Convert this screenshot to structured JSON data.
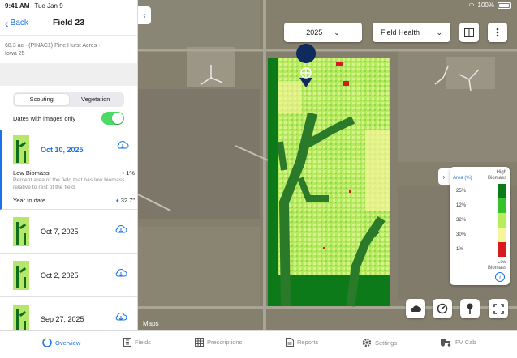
{
  "status_bar": {
    "time": "9:41 AM",
    "date": "Tue Jan 9",
    "battery": "100%"
  },
  "nav": {
    "back_label": "Back",
    "title": "Field 23"
  },
  "field_info": {
    "line1": "68.3 ac · (PINAC1) Pine Hurst Acres ·",
    "line2": "Iowa 25"
  },
  "segments": [
    {
      "label": "Scouting",
      "active": true
    },
    {
      "label": "Vegetation",
      "active": false
    }
  ],
  "toggle": {
    "label": "Dates with images only",
    "on": true
  },
  "dates": {
    "selected": {
      "label": "Oct 10, 2025",
      "metric_title": "Low Biomass",
      "metric_value": "1%",
      "metric_desc": "Percent area of the field that has low biomass relative to rest of the field.",
      "ytd_label": "Year to date",
      "ytd_value": "32.7\""
    },
    "others": [
      "Oct 7, 2025",
      "Oct 2, 2025",
      "Sep 27, 2025"
    ]
  },
  "map": {
    "year": "2025",
    "view": "Field Health",
    "maps_logo": "Maps",
    "legend": {
      "area_label": "Area (%)",
      "high_label": "High Biomass",
      "low_label": "Low Biomass",
      "rows": [
        {
          "pct": "25%",
          "color": "#0d7a19"
        },
        {
          "pct": "12%",
          "color": "#35c22a"
        },
        {
          "pct": "32%",
          "color": "#b8ec5a"
        },
        {
          "pct": "30%",
          "color": "#f6f59a"
        },
        {
          "pct": "1%",
          "color": "#d71920"
        }
      ]
    }
  },
  "tabbar": [
    {
      "label": "Overview",
      "icon": "overview-icon",
      "active": true
    },
    {
      "label": "Fields",
      "icon": "fields-icon",
      "active": false
    },
    {
      "label": "Prescriptions",
      "icon": "prescriptions-icon",
      "active": false
    },
    {
      "label": "Reports",
      "icon": "reports-icon",
      "active": false
    },
    {
      "label": "Settings",
      "icon": "gear-icon",
      "active": false
    },
    {
      "label": "FV Cab",
      "icon": "tractor-icon",
      "active": false
    }
  ],
  "colors": {
    "accent": "#1a73e8",
    "toggle_on": "#4cd964",
    "low_biomass": "#d71920"
  }
}
